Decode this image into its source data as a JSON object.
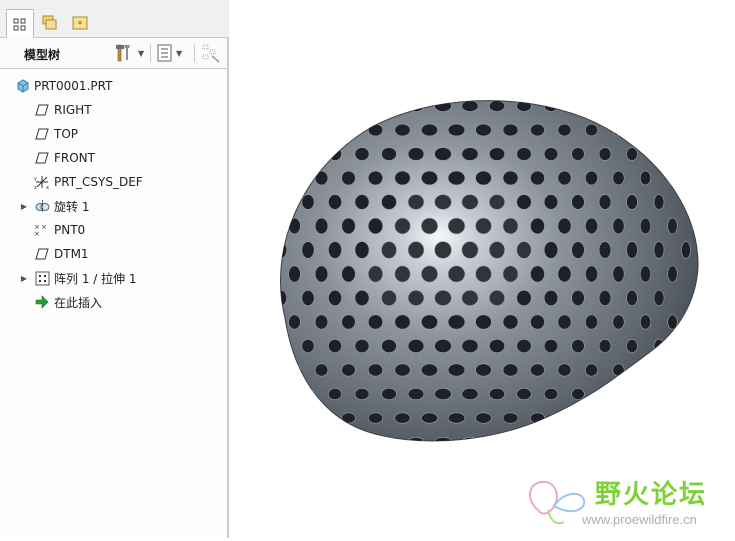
{
  "panel_tabs": [
    {
      "name": "model-tree-tab",
      "icon": "tree-icon",
      "active": true
    },
    {
      "name": "folder-browser-tab",
      "icon": "folders-icon",
      "active": false
    },
    {
      "name": "favorites-tab",
      "icon": "star-folder-icon",
      "active": false
    }
  ],
  "toolbar": {
    "title": "模型树",
    "settings_icon": "hammer-icon",
    "show_icon": "list-icon",
    "filter_icon": "filter-icon"
  },
  "tree": {
    "items": [
      {
        "label": "PRT0001.PRT",
        "icon": "part-icon",
        "expandable": false
      },
      {
        "label": "RIGHT",
        "icon": "datum-plane-icon",
        "expandable": false
      },
      {
        "label": "TOP",
        "icon": "datum-plane-icon",
        "expandable": false
      },
      {
        "label": "FRONT",
        "icon": "datum-plane-icon",
        "expandable": false
      },
      {
        "label": "PRT_CSYS_DEF",
        "icon": "csys-icon",
        "expandable": false
      },
      {
        "label": "旋转 1",
        "icon": "revolve-icon",
        "expandable": true
      },
      {
        "label": "PNT0",
        "icon": "datum-point-icon",
        "expandable": false
      },
      {
        "label": "DTM1",
        "icon": "datum-plane-icon",
        "expandable": false
      },
      {
        "label": "阵列 1 / 拉伸 1",
        "icon": "pattern-icon",
        "expandable": true
      },
      {
        "label": "在此插入",
        "icon": "insert-arrow-icon",
        "expandable": false
      }
    ]
  },
  "graphics": {
    "model": "perforated-dome",
    "colors": {
      "shell": "#7a8088",
      "shell_light": "#eef1f4",
      "shell_dark": "#3d434b",
      "hole": "#1e2228"
    }
  },
  "watermark": {
    "text": "野火论坛",
    "url": "www.proewildfire.cn"
  }
}
